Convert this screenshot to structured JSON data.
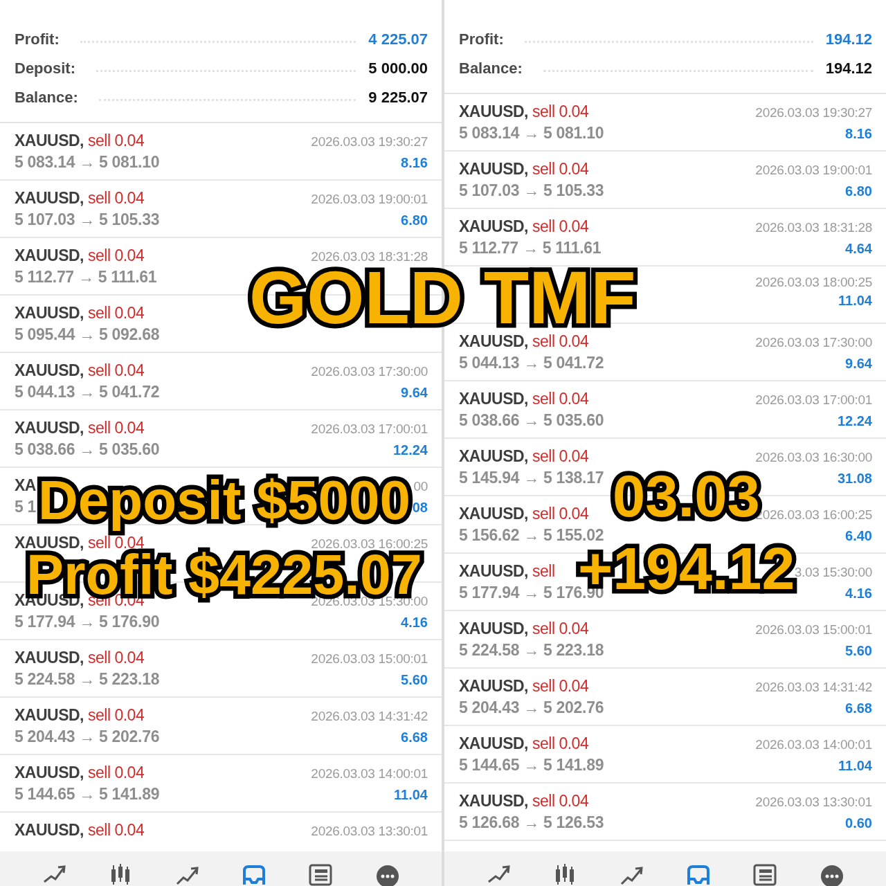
{
  "panels": [
    {
      "summary": [
        {
          "label": "Profit:",
          "value": "4 225.07",
          "kind": "profit"
        },
        {
          "label": "Deposit:",
          "value": "5 000.00",
          "kind": "plain"
        },
        {
          "label": "Balance:",
          "value": "9 225.07",
          "kind": "plain"
        }
      ],
      "trades": [
        {
          "symbol": "XAUUSD,",
          "side": "sell 0.04",
          "time": "2026.03.03 19:30:27",
          "prices": "5 083.14 → 5 081.10",
          "profit": "8.16"
        },
        {
          "symbol": "XAUUSD,",
          "side": "sell 0.04",
          "time": "2026.03.03 19:00:01",
          "prices": "5 107.03 → 5 105.33",
          "profit": "6.80"
        },
        {
          "symbol": "XAUUSD,",
          "side": "sell 0.04",
          "time": "2026.03.03 18:31:28",
          "prices": "5 112.77 → 5 111.61"
        },
        {
          "symbol": "XAUUSD,",
          "side": "sell 0.04",
          "prices": "5 095.44 → 5 092.68"
        },
        {
          "symbol": "XAUUSD,",
          "side": "sell 0.04",
          "time": "2026.03.03 17:30:00",
          "prices": "5 044.13 → 5 041.72",
          "profit": "9.64"
        },
        {
          "symbol": "XAUUSD,",
          "side": "sell 0.04",
          "time": "2026.03.03 17:00:01",
          "prices": "5 038.66 → 5 035.60",
          "profit": "12.24"
        },
        {
          "symbol": "XA",
          "time": "00",
          "prices": "5 1",
          "profit": "08"
        },
        {
          "symbol": "XAUUSD,",
          "side": "sell 0.04",
          "time": "2026.03.03 16:00:25"
        },
        {
          "symbol": "XAUUSD,",
          "side": "sell 0.04",
          "time": "2026.03.03 15:30:00",
          "prices": "5 177.94 → 5 176.90",
          "profit": "4.16"
        },
        {
          "symbol": "XAUUSD,",
          "side": "sell 0.04",
          "time": "2026.03.03 15:00:01",
          "prices": "5 224.58 → 5 223.18",
          "profit": "5.60"
        },
        {
          "symbol": "XAUUSD,",
          "side": "sell 0.04",
          "time": "2026.03.03 14:31:42",
          "prices": "5 204.43 → 5 202.76",
          "profit": "6.68"
        },
        {
          "symbol": "XAUUSD,",
          "side": "sell 0.04",
          "time": "2026.03.03 14:00:01",
          "prices": "5 144.65 → 5 141.89",
          "profit": "11.04"
        },
        {
          "symbol": "XAUUSD,",
          "side": "sell 0.04",
          "time": "2026.03.03 13:30:01"
        }
      ],
      "nav": [
        {
          "selected": false
        },
        {
          "selected": false
        },
        {
          "selected": false
        },
        {
          "selected": true
        },
        {
          "selected": false
        },
        {
          "selected": false
        }
      ]
    },
    {
      "summary": [
        {
          "label": "Profit:",
          "value": "194.12",
          "kind": "profit"
        },
        {
          "label": "Balance:",
          "value": "194.12",
          "kind": "plain"
        }
      ],
      "trades": [
        {
          "symbol": "XAUUSD,",
          "side": "sell 0.04",
          "time": "2026.03.03 19:30:27",
          "prices": "5 083.14 → 5 081.10",
          "profit": "8.16"
        },
        {
          "symbol": "XAUUSD,",
          "side": "sell 0.04",
          "time": "2026.03.03 19:00:01",
          "prices": "5 107.03 → 5 105.33",
          "profit": "6.80"
        },
        {
          "symbol": "XAUUSD,",
          "side": "sell 0.04",
          "time": "2026.03.03 18:31:28",
          "prices": "5 112.77 → 5 111.61",
          "profit": "4.64"
        },
        {
          "time": "2026.03.03 18:00:25",
          "profit": "11.04"
        },
        {
          "symbol": "XAUUSD,",
          "side": "sell 0.04",
          "time": "2026.03.03 17:30:00",
          "prices": "5 044.13 → 5 041.72",
          "profit": "9.64"
        },
        {
          "symbol": "XAUUSD,",
          "side": "sell 0.04",
          "time": "2026.03.03 17:00:01",
          "prices": "5 038.66 → 5 035.60",
          "profit": "12.24"
        },
        {
          "symbol": "XAUUSD,",
          "side": "sell 0.04",
          "time": "2026.03.03 16:30:00",
          "prices": "5 145.94 → 5 138.17",
          "profit": "31.08"
        },
        {
          "symbol": "XAUUSD,",
          "side": "sell 0.04",
          "time": "2026.03.03 16:00:25",
          "prices": "5 156.62 → 5 155.02",
          "profit": "6.40"
        },
        {
          "symbol": "XAUUSD,",
          "side": "sell",
          "time": "3.03 15:30:00",
          "prices": "5 177.94 → 5 176.90",
          "profit": "4.16"
        },
        {
          "symbol": "XAUUSD,",
          "side": "sell 0.04",
          "time": "2026.03.03 15:00:01",
          "prices": "5 224.58 → 5 223.18",
          "profit": "5.60"
        },
        {
          "symbol": "XAUUSD,",
          "side": "sell 0.04",
          "time": "2026.03.03 14:31:42",
          "prices": "5 204.43 → 5 202.76",
          "profit": "6.68"
        },
        {
          "symbol": "XAUUSD,",
          "side": "sell 0.04",
          "time": "2026.03.03 14:00:01",
          "prices": "5 144.65 → 5 141.89",
          "profit": "11.04"
        },
        {
          "symbol": "XAUUSD,",
          "side": "sell 0.04",
          "time": "2026.03.03 13:30:01",
          "prices": "5 126.68 → 5 126.53",
          "profit": "0.60"
        }
      ],
      "nav": [
        {
          "selected": false
        },
        {
          "selected": false
        },
        {
          "selected": false
        },
        {
          "selected": true
        },
        {
          "selected": false
        },
        {
          "selected": false
        }
      ]
    }
  ],
  "captions": [
    "GOLD TMF",
    "Deposit $5000",
    "Profit $4225.07",
    "03.03",
    "+194.12"
  ]
}
